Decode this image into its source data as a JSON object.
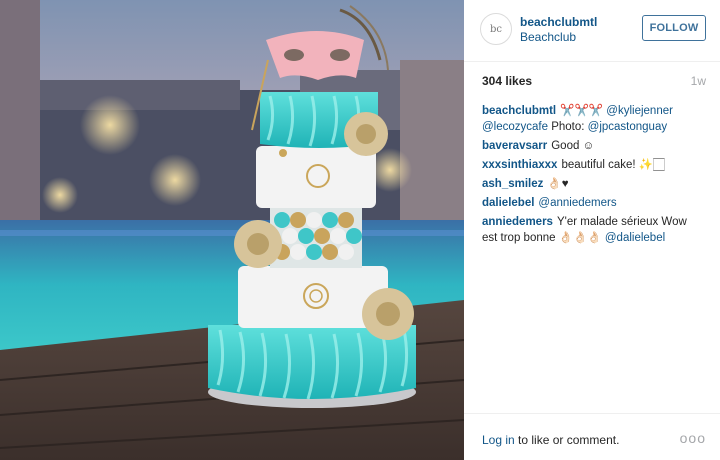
{
  "colors": {
    "link": "#125688",
    "muted": "#a5a7aa",
    "follow": "#3f729b",
    "turquoise": "#2ec7c7"
  },
  "photo": {
    "alt_icon": "cake-photo"
  },
  "header": {
    "avatar_text": "bc",
    "username": "beachclubmtl",
    "location": "Beachclub",
    "follow_label": "FOLLOW"
  },
  "post": {
    "likes": "304 likes",
    "time": "1w"
  },
  "comments": [
    {
      "user": "beachclubmtl",
      "parts": [
        {
          "t": "text",
          "v": "✂️✂️✂️ "
        },
        {
          "t": "mention",
          "v": "@kyliejenner"
        },
        {
          "t": "text",
          "v": " "
        },
        {
          "t": "mention",
          "v": "@lecozycafe"
        },
        {
          "t": "text",
          "v": " Photo: "
        },
        {
          "t": "mention",
          "v": "@jpcastonguay"
        }
      ]
    },
    {
      "user": "baveravsarr",
      "parts": [
        {
          "t": "text",
          "v": "Good ☺"
        }
      ]
    },
    {
      "user": "xxxsinthiaxxx",
      "parts": [
        {
          "t": "text",
          "v": "beautiful cake! ✨🏻"
        }
      ]
    },
    {
      "user": "ash_smilez",
      "parts": [
        {
          "t": "text",
          "v": "👌🏻♥"
        }
      ]
    },
    {
      "user": "dalielebel",
      "parts": [
        {
          "t": "mention",
          "v": "@anniedemers"
        }
      ]
    },
    {
      "user": "anniedemers",
      "parts": [
        {
          "t": "text",
          "v": "Y'er malade sérieux Wow est trop bonne 👌🏻👌🏻👌🏻 "
        },
        {
          "t": "mention",
          "v": "@dalielebel"
        }
      ]
    }
  ],
  "footer": {
    "login_link": "Log in",
    "login_rest": " to like or comment.",
    "more": "ooo"
  }
}
